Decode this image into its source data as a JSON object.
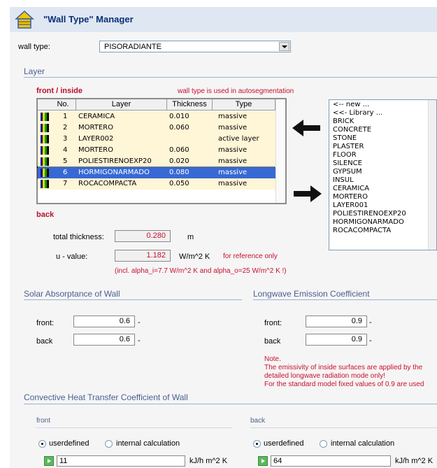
{
  "window": {
    "title": "\"Wall Type\" Manager"
  },
  "wall_type": {
    "label": "wall type:",
    "selected": "PISORADIANTE"
  },
  "layer_section": {
    "title": "Layer",
    "front_label": "front / inside",
    "warning": "wall type is used in autosegmentation",
    "back_label": "back",
    "table": {
      "columns": [
        "No.",
        "Layer",
        "Thickness",
        "Type"
      ],
      "rows": [
        {
          "no": "1",
          "layer": "CERAMICA",
          "thickness": "0.010",
          "type": "massive"
        },
        {
          "no": "2",
          "layer": "MORTERO",
          "thickness": "0.060",
          "type": "massive"
        },
        {
          "no": "3",
          "layer": "LAYER002",
          "thickness": "",
          "type": "active layer"
        },
        {
          "no": "4",
          "layer": "MORTERO",
          "thickness": "0.060",
          "type": "massive"
        },
        {
          "no": "5",
          "layer": "POLIESTIRENOEXP20",
          "thickness": "0.020",
          "type": "massive"
        },
        {
          "no": "6",
          "layer": "HORMIGONARMADO",
          "thickness": "0.080",
          "type": "massive"
        },
        {
          "no": "7",
          "layer": "ROCACOMPACTA",
          "thickness": "0.050",
          "type": "massive"
        }
      ],
      "selected_row": 6
    },
    "library": [
      "<-- new ...",
      "<<- Library ...",
      "BRICK",
      "CONCRETE",
      "STONE",
      "PLASTER",
      "FLOOR",
      "SILENCE",
      "GYPSUM",
      "INSUL",
      "CERAMICA",
      "MORTERO",
      "LAYER001",
      "POLIESTIRENOEXP20",
      "HORMIGONARMADO",
      "ROCACOMPACTA"
    ],
    "total_thickness": {
      "label": "total thickness:",
      "value": "0.280",
      "unit": "m"
    },
    "u_value": {
      "label": "u - value:",
      "value": "1.182",
      "unit": "W/m^2 K",
      "note": "for reference only"
    },
    "alpha_note": "(incl. alpha_i=7.7 W/m^2 K and alpha_o=25 W/m^2 K !)"
  },
  "solar": {
    "title": "Solar Absorptance of Wall",
    "front_label": "front:",
    "front_value": "0.6",
    "front_unit": "-",
    "back_label": "back",
    "back_value": "0.6",
    "back_unit": "-"
  },
  "longwave": {
    "title": "Longwave Emission Coefficient",
    "front_label": "front:",
    "front_value": "0.9",
    "front_unit": "-",
    "back_label": "back",
    "back_value": "0.9",
    "back_unit": "-",
    "note_title": "Note.",
    "note_1": "The emissivity of inside surfaces are applied by the",
    "note_2": "detailed longwave radiation mode only!",
    "note_3": "For the standard model fixed values of 0.9 are used"
  },
  "convective": {
    "title": "Convective Heat Transfer Coefficient of Wall",
    "front": {
      "label": "front",
      "opt1": "userdefined",
      "opt2": "internal calculation",
      "value": "11",
      "unit": "kJ/h m^2 K"
    },
    "back": {
      "label": "back",
      "opt1": "userdefined",
      "opt2": "internal calculation",
      "value": "64",
      "unit": "kJ/h m^2 K"
    }
  },
  "colors": {
    "accent": "#3769d4",
    "section": "#4a5f8f",
    "warning": "#c8102e",
    "row_bg": "#fff5d7"
  }
}
